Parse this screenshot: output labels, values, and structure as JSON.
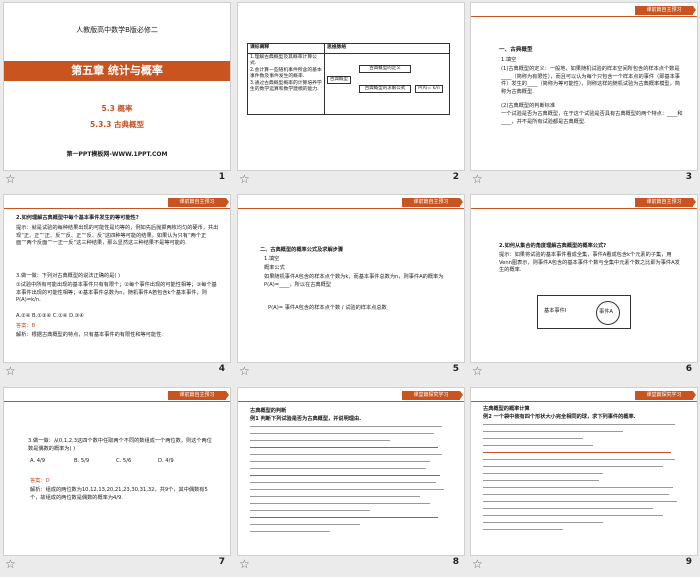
{
  "slides": [
    {
      "num": "1",
      "book": "人教版高中数学B版必修二",
      "chapter": "第五章 统计与概率",
      "section": "5.3  概率",
      "subsection": "5.3.3   古典概型",
      "footer": "第一PPT模板网-WWW.1PPT.COM"
    },
    {
      "num": "2",
      "header_left": "课标阐释",
      "header_right": "思维脉络",
      "goals": [
        "1.理解古典概型及其概率计算公式.",
        "2.会计算一些随机事件所含的基本事件数及事件发生的概率.",
        "3.通过古典概型概率的计算培养学生的数学运算和数学建模的能力."
      ],
      "mind_root": "古典概型",
      "mind_a": "古典概型的定义",
      "mind_b": "古典概型的求解公式",
      "mind_formula": "P(A)= k/n"
    },
    {
      "num": "3",
      "tag": "课前篇自主预习",
      "heading": "一、古典概型",
      "item": "1.填空",
      "text": "(1)古典概型的定义：一般地，如果随机试验的样本空间所包含的样本点个数是____（简称为有限性），而且可以认为每个只包含一个样本点的事件（即基本事件）发生的____（简称为等可能性），则称这样的随机试验为古典概率模型，简称为古典概型.",
      "text2": "(2)古典概型的判断标准",
      "text3": "一个试验是否为古典概型，在于这个试验是否具有古典概型的两个特点：____和____，并不是所有试验都是古典概型."
    },
    {
      "num": "4",
      "tag": "课前篇自主预习",
      "q1": "2.如何理解古典概型中每个基本事件发生的等可能性?",
      "tip": "提示：就是试验的每种结果出现的可能性是均等的，例如先后抛掷两枚均匀的硬币，共出现“正、正”“正、反”“反、正”“反、反”这四种等可能的结果，如果认为只有“两个正面”“两个反面”“一正一反”这三种结果，那么显然这三种结果不是等可能的.",
      "q2": "3.做一做：下列对古典概型的说法正确的是(    )",
      "items": "①试验中所有可能出现的基本事件只有有限个；②每个事件出现的可能性相等；③每个基本事件出现的可能性相等；④基本事件总数为n，随机事件A若包含k个基本事件，则P(A)=k/n.",
      "options": "A.②④    B.①③④    C.①④    D.③④",
      "answer": "答案：B",
      "analysis": "解析：根据古典概型的特点，只有基本事件的有限性和等可能性."
    },
    {
      "num": "5",
      "tag": "课前篇自主预习",
      "heading": "二、古典概型的概率公式及求解步骤",
      "item": "1.填空",
      "text": "概率公式",
      "text2": "如果随机事件A包含的样本点个数为k，而基本事件总数为n，则事件A的概率为P(A)=____，所以在古典概型",
      "formula": "P(A)= 事件A包含的样本点个数 / 试验的样本点总数"
    },
    {
      "num": "6",
      "tag": "课前篇自主预习",
      "q": "2.如何从集合的角度理解古典概型的概率公式?",
      "tip": "提示：如果将试验的基本事件看成全集，事件A看成包含k个元素的子集，用Venn图表示，则事件A包含的基本事件个数与全集中元素个数之比即为事件A发生的概率.",
      "venn_outer": "基本事件I",
      "venn_inner": "事件A"
    },
    {
      "num": "7",
      "tag": "课前篇自主预习",
      "q": "3.做一做：从0,1,2,3这四个数中任取两个不同的数组成一个两位数，则这个两位数是偶数的概率为(    )",
      "opts": [
        "A. 4/9",
        "B. 5/9",
        "C. 5/6",
        "D. 4/9"
      ],
      "answer": "答案：D",
      "analysis": "解析：组成的两位数为10,12,13,20,21,23,30,31,32，共9个，其中偶数有5个，故组成的两位数是偶数的概率为4/9."
    },
    {
      "num": "8",
      "tag": "课堂篇探究学习",
      "heading": "古典概型的判断",
      "ex": "例1 判断下列试验是否为古典概型，并说明理由."
    },
    {
      "num": "9",
      "tag": "课堂篇探究学习",
      "heading": "古典概型的概率计算",
      "ex": "例2 一个袋中装有四个形状大小完全相同的球，求下列事件的概率."
    }
  ]
}
